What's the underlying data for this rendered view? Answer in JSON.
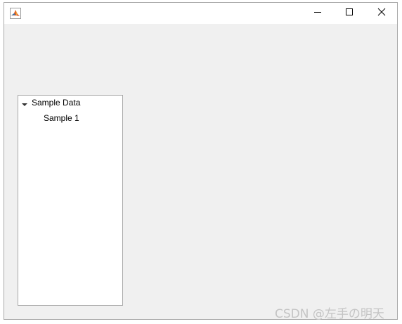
{
  "window": {
    "icon": "matlab-icon",
    "controls": {
      "minimize_icon": "minimize-icon",
      "maximize_icon": "maximize-icon",
      "close_icon": "close-icon"
    }
  },
  "tree": {
    "root": {
      "label": "Sample Data",
      "expanded": true,
      "icon": "caret-down-icon"
    },
    "children": [
      {
        "label": "Sample 1"
      }
    ]
  },
  "watermark": {
    "text": "CSDN @左手の明天"
  }
}
